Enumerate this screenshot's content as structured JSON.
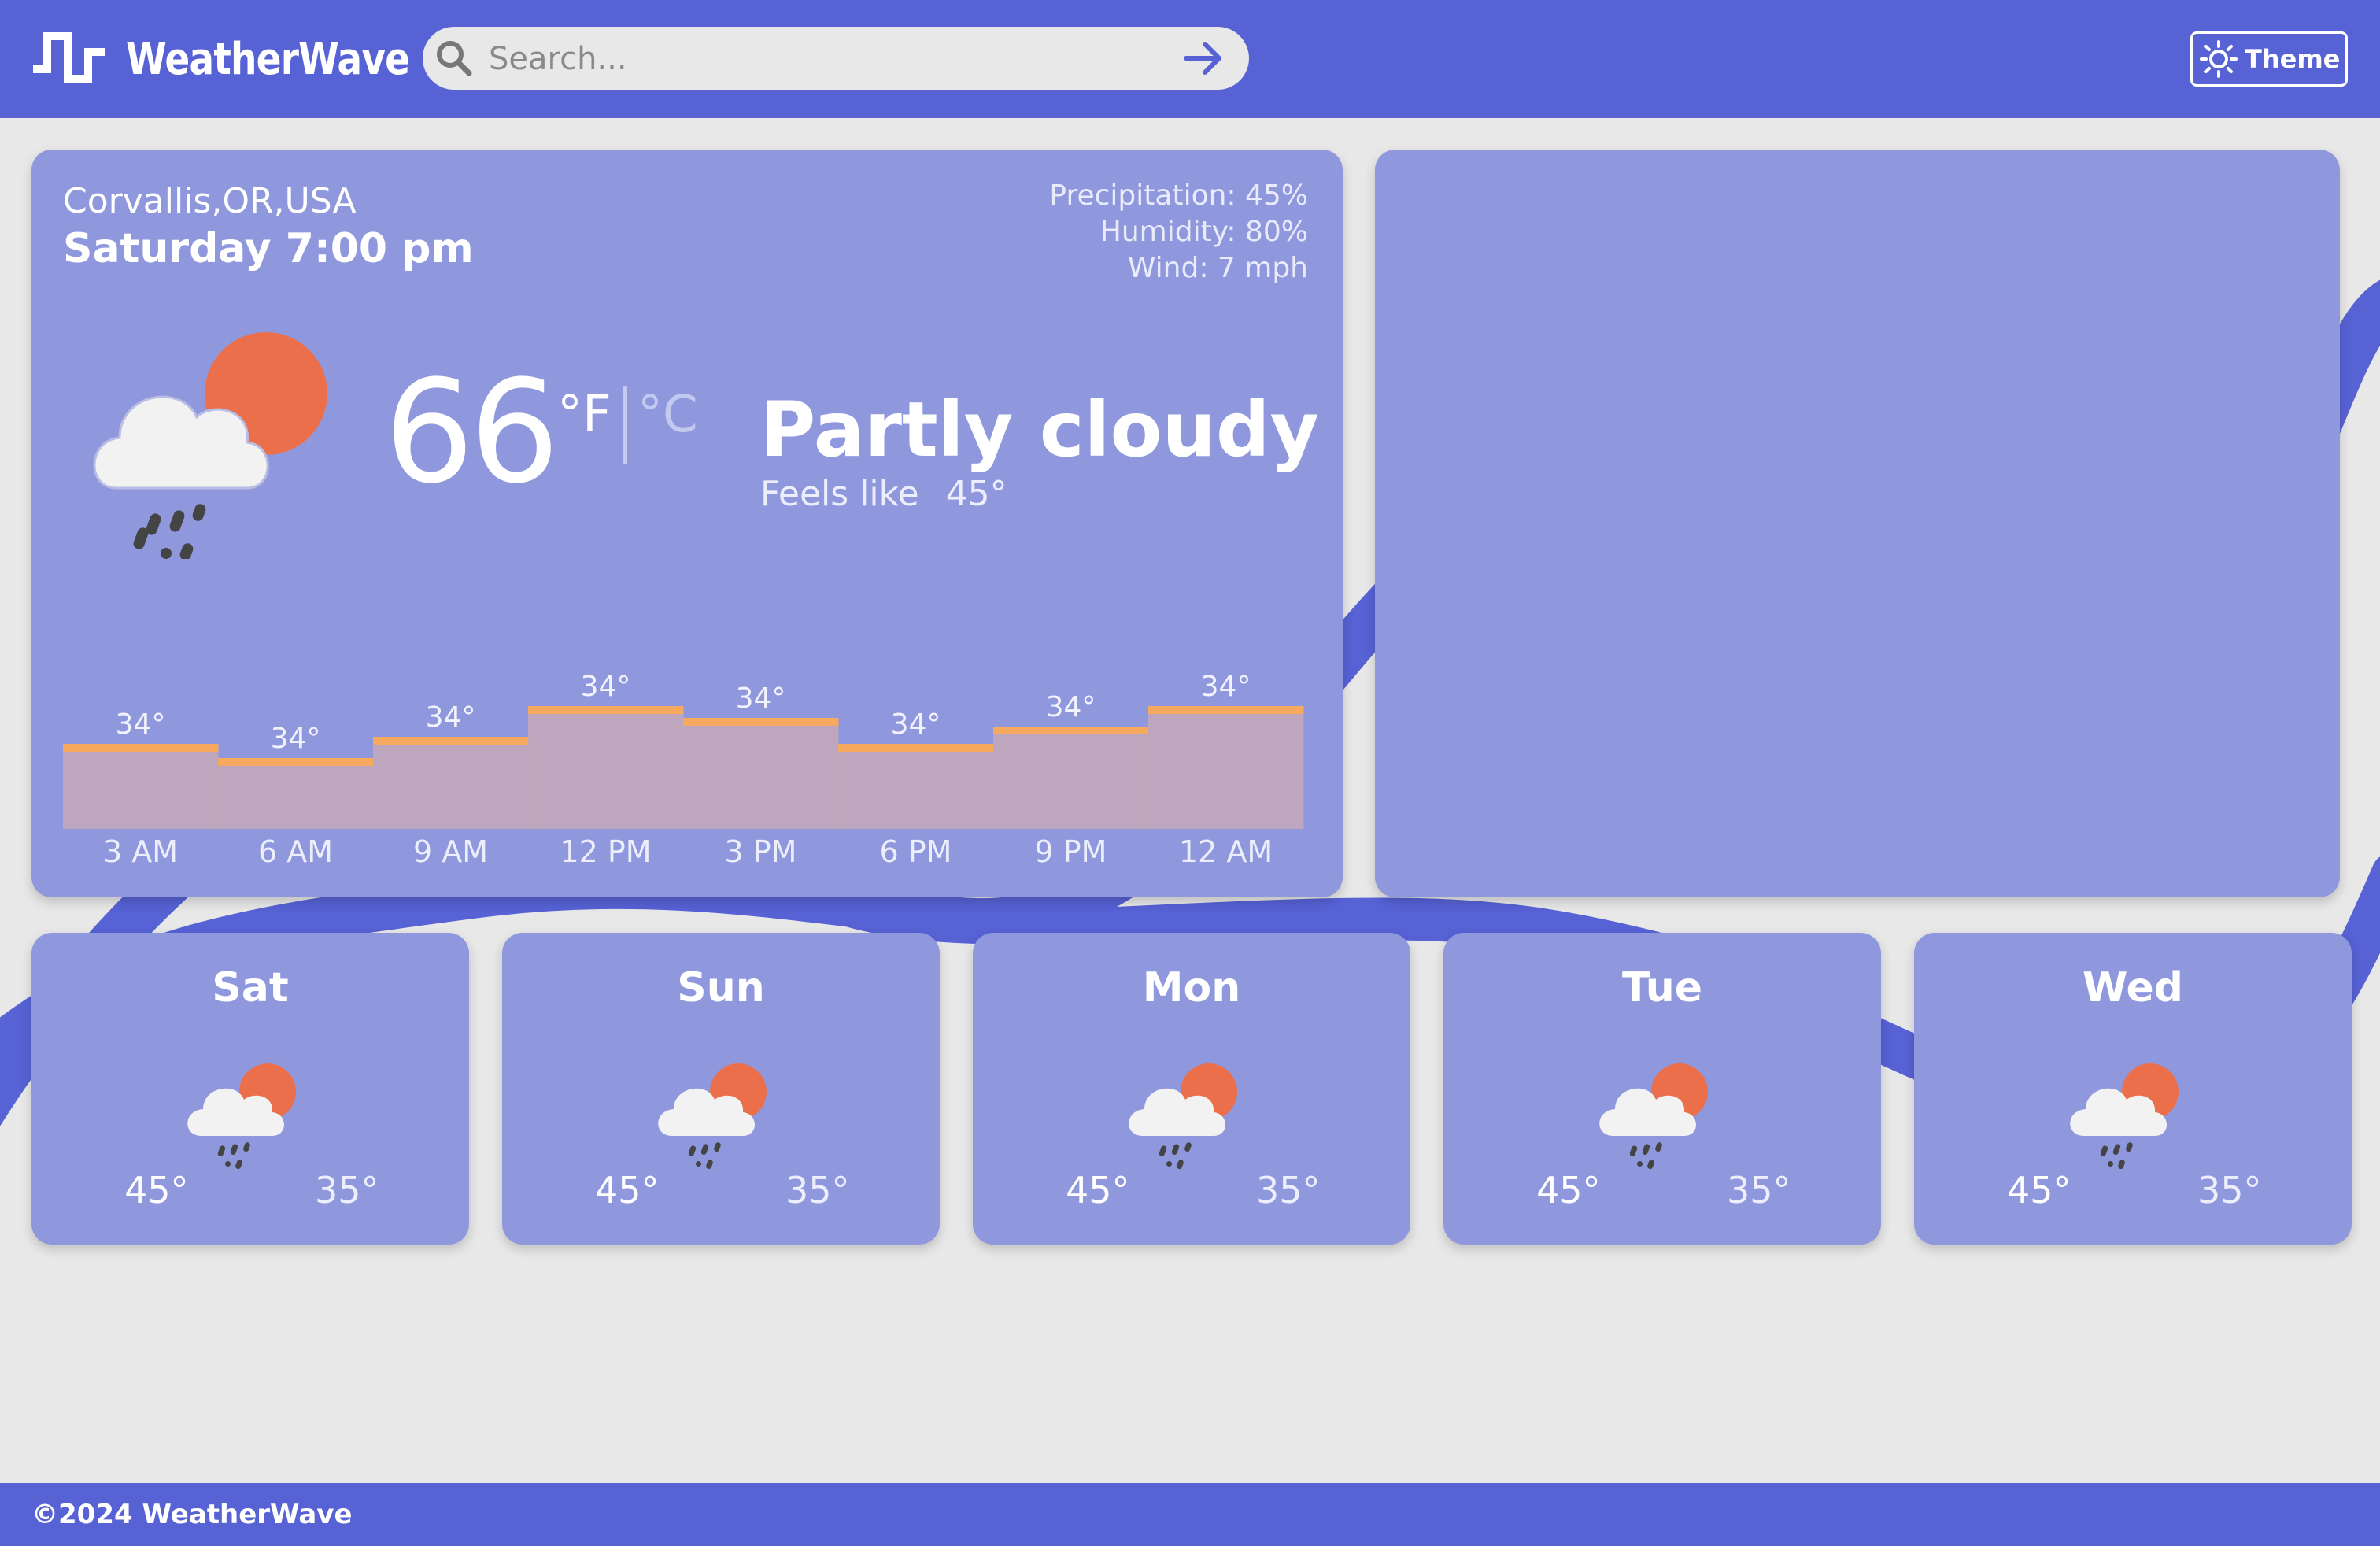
{
  "header": {
    "brand": "WeatherWave",
    "search_placeholder": "Search...",
    "theme_label": "Theme"
  },
  "current": {
    "location": "Corvallis,OR,USA",
    "datetime": "Saturday 7:00 pm",
    "precipitation": "Precipitation: 45%",
    "humidity": "Humidity: 80%",
    "wind": "Wind: 7 mph",
    "temperature": "66",
    "unit_f": "°F",
    "unit_c": "°C",
    "condition": "Partly cloudy",
    "feels_like_label": "Feels like",
    "feels_like_value": "45°",
    "icon": "partly-cloudy-rain-icon"
  },
  "hourly": [
    {
      "time": "3 AM",
      "label": "34°",
      "level": 0.47
    },
    {
      "time": "6 AM",
      "label": "34°",
      "level": 0.28
    },
    {
      "time": "9 AM",
      "label": "34°",
      "level": 0.57
    },
    {
      "time": "12 PM",
      "label": "34°",
      "level": 1.0
    },
    {
      "time": "3 PM",
      "label": "34°",
      "level": 0.83
    },
    {
      "time": "6 PM",
      "label": "34°",
      "level": 0.47
    },
    {
      "time": "9 PM",
      "label": "34°",
      "level": 0.71
    },
    {
      "time": "12 AM",
      "label": "34°",
      "level": 1.0
    }
  ],
  "forecast": [
    {
      "day": "Sat",
      "high": "45°",
      "low": "35°",
      "icon": "partly-cloudy-rain-icon"
    },
    {
      "day": "Sun",
      "high": "45°",
      "low": "35°",
      "icon": "partly-cloudy-rain-icon"
    },
    {
      "day": "Mon",
      "high": "45°",
      "low": "35°",
      "icon": "partly-cloudy-rain-icon"
    },
    {
      "day": "Tue",
      "high": "45°",
      "low": "35°",
      "icon": "partly-cloudy-rain-icon"
    },
    {
      "day": "Wed",
      "high": "45°",
      "low": "35°",
      "icon": "partly-cloudy-rain-icon"
    }
  ],
  "footer": {
    "copyright": "©2024 WeatherWave"
  },
  "colors": {
    "primary": "#5762d5",
    "card": "#8f98dd",
    "background": "#e8e8e8",
    "sun": "#ec6f4b",
    "hourly_line": "#f7a95f",
    "hourly_fill": "#c6a8b8"
  }
}
